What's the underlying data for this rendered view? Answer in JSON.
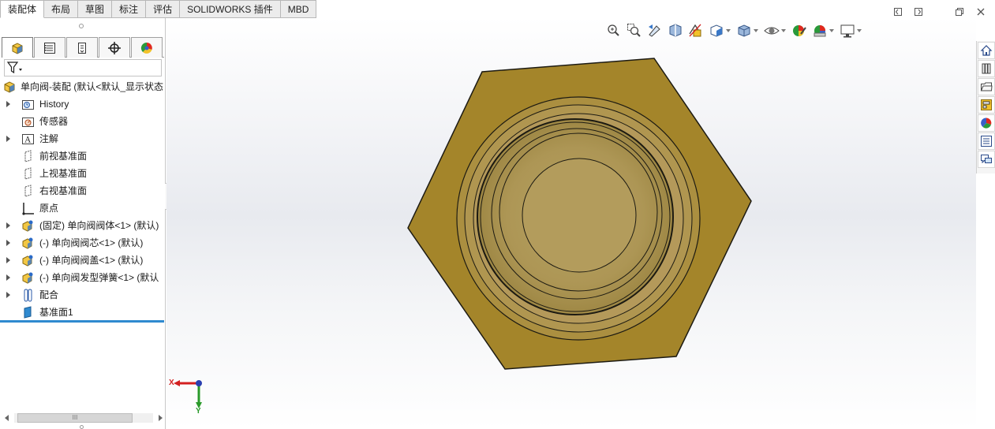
{
  "command_tabs": [
    {
      "label": "装配体",
      "active": true
    },
    {
      "label": "布局",
      "active": false
    },
    {
      "label": "草图",
      "active": false
    },
    {
      "label": "标注",
      "active": false
    },
    {
      "label": "评估",
      "active": false
    },
    {
      "label": "SOLIDWORKS 插件",
      "active": false
    },
    {
      "label": "MBD",
      "active": false
    }
  ],
  "panel_tabs": [
    {
      "icon": "feature-manager-icon"
    },
    {
      "icon": "property-manager-icon"
    },
    {
      "icon": "configuration-manager-icon"
    },
    {
      "icon": "dimxpert-manager-icon"
    },
    {
      "icon": "display-manager-icon"
    }
  ],
  "feature_tree": {
    "root": "单向阀-装配  (默认<默认_显示状态",
    "items": [
      {
        "label": "History",
        "icon": "history-icon",
        "expandable": true
      },
      {
        "label": "传感器",
        "icon": "sensor-icon",
        "expandable": false
      },
      {
        "label": "注解",
        "icon": "annotation-icon",
        "expandable": true
      },
      {
        "label": "前视基准面",
        "icon": "plane-icon",
        "expandable": false
      },
      {
        "label": "上视基准面",
        "icon": "plane-icon",
        "expandable": false
      },
      {
        "label": "右视基准面",
        "icon": "plane-icon",
        "expandable": false
      },
      {
        "label": "原点",
        "icon": "origin-icon",
        "expandable": false
      },
      {
        "label": "(固定) 单向阀阀体<1> (默认)",
        "icon": "part-icon",
        "expandable": true
      },
      {
        "label": "(-) 单向阀阀芯<1> (默认)",
        "icon": "part-icon",
        "expandable": true
      },
      {
        "label": "(-) 单向阀阀盖<1> (默认)",
        "icon": "part-icon",
        "expandable": true
      },
      {
        "label": "(-) 单向阀发型弹簧<1> (默认",
        "icon": "part-icon",
        "expandable": true
      },
      {
        "label": "配合",
        "icon": "mates-icon",
        "expandable": true
      },
      {
        "label": "基准面1",
        "icon": "plane-icon",
        "expandable": false
      }
    ]
  },
  "scrollbar": {
    "thumb_label": "III"
  },
  "hud_toolbar": [
    {
      "icon": "zoom-to-fit-icon",
      "dropdown": false
    },
    {
      "icon": "zoom-to-area-icon",
      "dropdown": false
    },
    {
      "icon": "previous-view-icon",
      "dropdown": false
    },
    {
      "icon": "section-view-icon",
      "dropdown": false
    },
    {
      "icon": "dynamic-annotation-icon",
      "dropdown": false
    },
    {
      "icon": "view-orientation-icon",
      "dropdown": true
    },
    {
      "icon": "display-style-icon",
      "dropdown": true
    },
    {
      "icon": "hide-show-icon",
      "dropdown": true
    },
    {
      "icon": "edit-appearance-icon",
      "dropdown": false
    },
    {
      "icon": "apply-scene-icon",
      "dropdown": true
    },
    {
      "icon": "view-settings-icon",
      "dropdown": true
    }
  ],
  "window_controls": [
    "tile-left-icon",
    "tile-right-icon",
    "restore-icon",
    "close-icon"
  ],
  "task_pane": [
    "solidworks-resources-icon",
    "design-library-icon",
    "file-explorer-icon",
    "view-palette-icon",
    "appearances-icon",
    "custom-properties-icon",
    "forum-icon"
  ],
  "triad": {
    "x_label": "X",
    "y_label": "Y"
  },
  "colors": {
    "brass_outer": "#a4852a",
    "brass_inner": "#b39a52",
    "brass_cap": "#b09a5a",
    "edge": "#1c1a12",
    "accent_blue": "#2f8ad0",
    "axis_x": "#d32020",
    "axis_y": "#2a9a2a",
    "axis_z": "#2a3fb0"
  }
}
